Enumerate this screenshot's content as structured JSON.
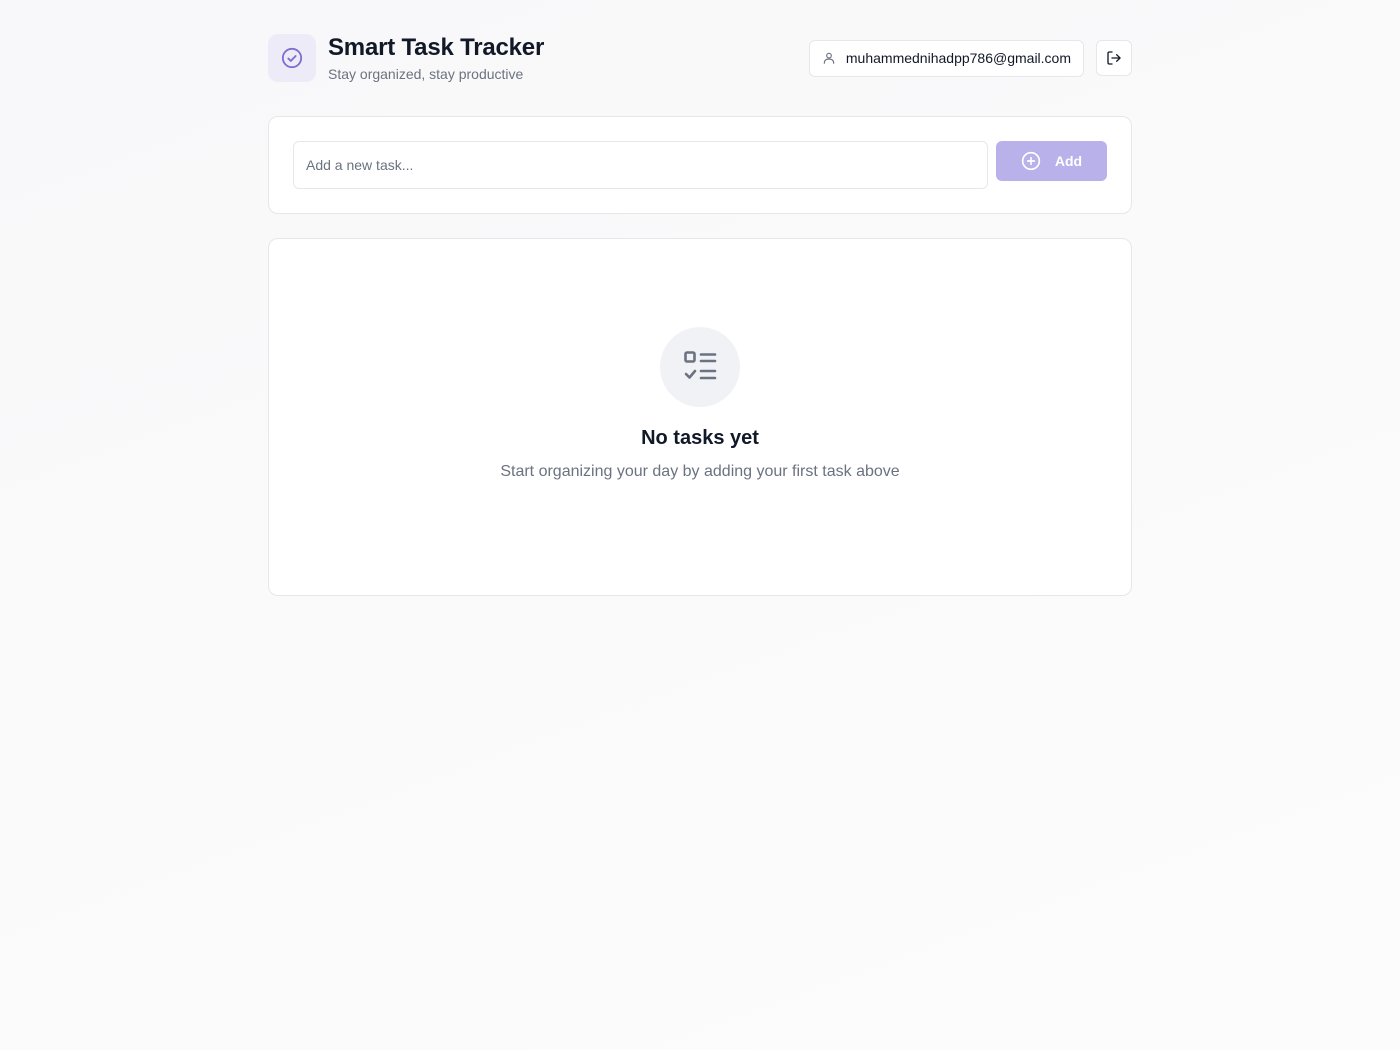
{
  "header": {
    "title": "Smart Task Tracker",
    "subtitle": "Stay organized, stay productive",
    "logo_icon": "check-circle-icon",
    "user_email": "muhammednihadpp786@gmail.com",
    "user_icon": "user-icon",
    "logout_icon": "logout-icon"
  },
  "add_task": {
    "placeholder": "Add a new task...",
    "value": "",
    "button_label": "Add",
    "button_icon": "plus-circle-icon"
  },
  "task_list": {
    "tasks": [],
    "empty_state": {
      "icon": "list-checks-icon",
      "title": "No tasks yet",
      "description": "Start organizing your day by adding your first task above"
    }
  },
  "colors": {
    "accent": "#7c6fd0",
    "accent_light": "#eeebf8",
    "button_disabled": "#b8b1ea",
    "text_primary": "#111827",
    "text_secondary": "#6b7280",
    "border": "#e5e7eb"
  }
}
